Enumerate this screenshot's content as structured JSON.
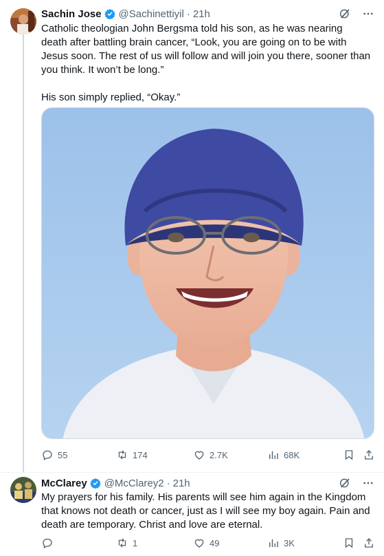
{
  "tweet1": {
    "author_name": "Sachin Jose",
    "handle": "@Sachinettiyil",
    "separator": "·",
    "time": "21h",
    "text_p1": "Catholic theologian John Bergsma told his son, as he was nearing death after battling brain cancer, “Look, you are going on to be with Jesus soon. The rest of us will follow and will join you there, sooner than you think. It won’t be long.”",
    "text_p2": "His son simply replied, “Okay.”",
    "replies": "55",
    "reposts": "174",
    "likes": "2.7K",
    "views": "68K"
  },
  "tweet2": {
    "author_name": "McClarey",
    "handle": "@McClarey2",
    "separator": "·",
    "time": "21h",
    "text": "My prayers for his family.  His parents will see him again in the Kingdom that knows not death or cancer, just as I will see my boy again. Pain and death are temporary.  Christ and love are eternal.",
    "reposts": "1",
    "likes": "49",
    "views": "3K"
  },
  "colors": {
    "text": "#0f1419",
    "muted": "#536471",
    "verified": "#1d9bf0",
    "thread_line": "#cfd9de",
    "sky": "#a9c9ec"
  }
}
